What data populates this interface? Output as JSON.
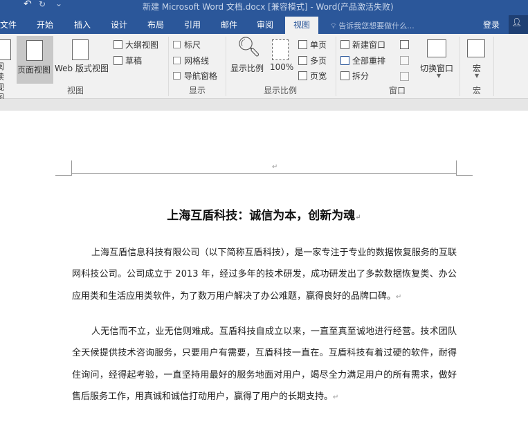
{
  "title": "新建 Microsoft Word 文档.docx [兼容模式] - Word(产品激活失败)",
  "tabs": [
    "文件",
    "开始",
    "插入",
    "设计",
    "布局",
    "引用",
    "邮件",
    "审阅",
    "视图"
  ],
  "tell_me": "告诉我您想要做什么...",
  "login": "登录",
  "ribbon": {
    "view": {
      "read": "阅读视图",
      "print": "页面视图",
      "web": "Web 版式视图",
      "outline": "大纲视图",
      "draft": "草稿",
      "label": "视图"
    },
    "show": {
      "ruler": "标尺",
      "grid": "网格线",
      "nav": "导航窗格",
      "label": "显示"
    },
    "zoom": {
      "zoom": "显示比例",
      "hundred": "100%",
      "one": "单页",
      "multi": "多页",
      "width": "页宽",
      "label": "显示比例"
    },
    "window": {
      "new": "新建窗口",
      "arrange": "全部重排",
      "split": "拆分",
      "switch": "切换窗口",
      "label": "窗口"
    },
    "macro": {
      "macro": "宏",
      "label": "宏"
    }
  },
  "doc": {
    "heading": "上海互盾科技：诚信为本，创新为魂",
    "p1": "上海互盾信息科技有限公司（以下简称互盾科技），是一家专注于专业的数据恢复服务的互联网科技公司。公司成立于 2013 年，经过多年的技术研发，成功研发出了多款数据恢复类、办公应用类和生活应用类软件，为了数万用户解决了办公难题，赢得良好的品牌口碑。",
    "p2": "人无信而不立，业无信则难成。互盾科技自成立以来，一直至真至诚地进行经营。技术团队全天候提供技术咨询服务，只要用户有需要，互盾科技一直在。互盾科技有着过硬的软件，耐得住询问，经得起考验，一直坚持用最好的服务地面对用户，竭尽全力满足用户的所有需求，做好售后服务工作，用真诚和诚信打动用户，赢得了用户的长期支持。",
    "pilcrow": "↵"
  }
}
